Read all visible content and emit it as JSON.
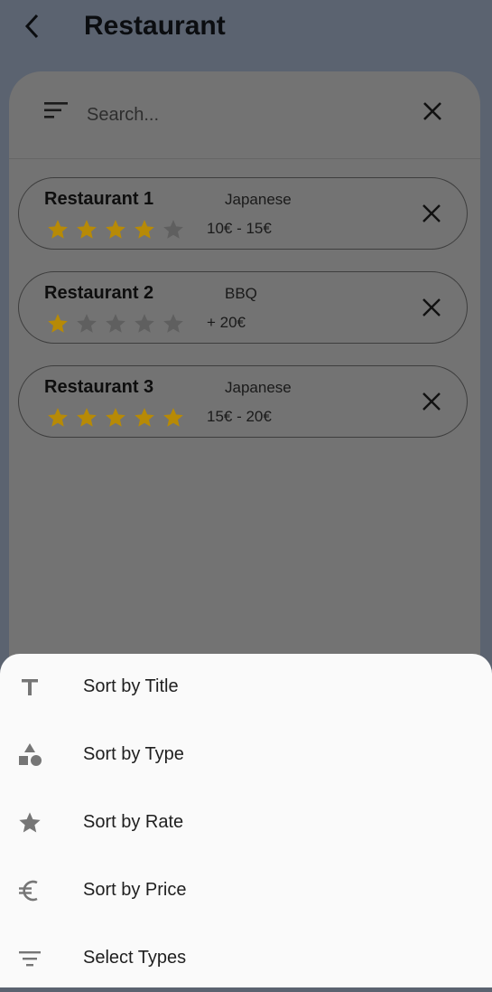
{
  "appbar": {
    "title": "Restaurant"
  },
  "search": {
    "placeholder": "Search..."
  },
  "restaurants": [
    {
      "name": "Restaurant 1",
      "type": "Japanese",
      "price": "10€ - 15€",
      "rating": 4
    },
    {
      "name": "Restaurant 2",
      "type": "BBQ",
      "price": "+ 20€",
      "rating": 1
    },
    {
      "name": "Restaurant 3",
      "type": "Japanese",
      "price": "15€ - 20€",
      "rating": 5
    }
  ],
  "sheet": {
    "items": [
      {
        "label": "Sort by Title",
        "icon": "title-icon"
      },
      {
        "label": "Sort by Type",
        "icon": "category-icon"
      },
      {
        "label": "Sort by Rate",
        "icon": "star-icon"
      },
      {
        "label": "Sort by Price",
        "icon": "euro-icon"
      },
      {
        "label": "Select Types",
        "icon": "filter-icon"
      }
    ]
  },
  "colors": {
    "star_filled": "#b78a06",
    "star_empty": "#5f5f5f",
    "scrim_bg": "#5b6370",
    "sheet_bg": "#fafafa"
  }
}
